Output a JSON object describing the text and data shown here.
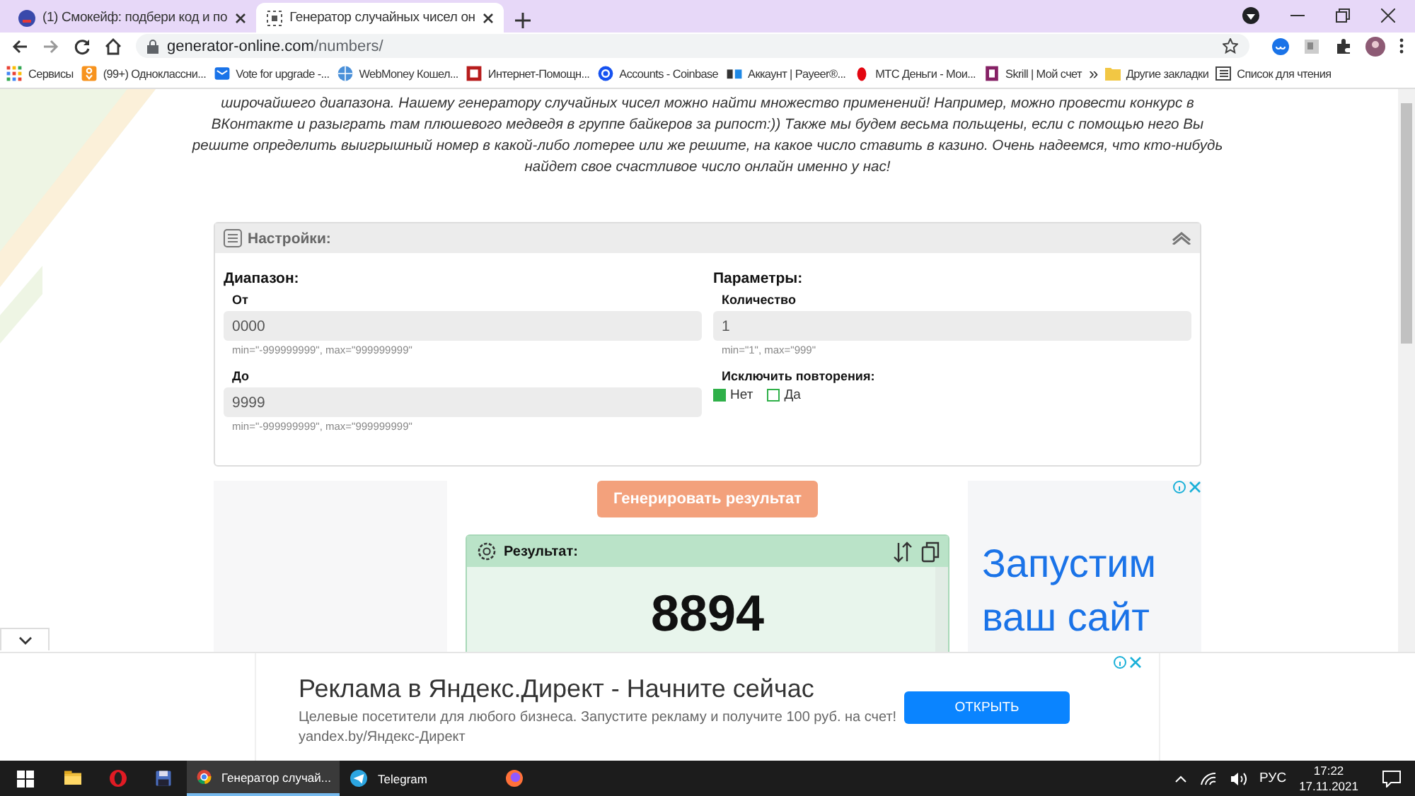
{
  "browser": {
    "tabs": [
      {
        "title": "(1) Смокейф: подбери код и по",
        "selected": false
      },
      {
        "title": "Генератор случайных чисел он",
        "selected": true
      }
    ],
    "url": {
      "host": "generator-online.com",
      "path": "/numbers/"
    },
    "bookmarks": [
      {
        "label": "Сервисы",
        "kind": "apps"
      },
      {
        "label": "(99+) Одноклассни...",
        "kind": "ok"
      },
      {
        "label": "Vote for upgrade -...",
        "kind": "mail"
      },
      {
        "label": "WebMoney Кошел...",
        "kind": "globe"
      },
      {
        "label": "Интернет-Помощн...",
        "kind": "red"
      },
      {
        "label": "Accounts - Coinbase",
        "kind": "coinbase"
      },
      {
        "label": "Аккаунт | Payeer®...",
        "kind": "payeer"
      },
      {
        "label": "МТС Деньги - Мои...",
        "kind": "mts"
      },
      {
        "label": "Skrill | Мой счет",
        "kind": "skrill"
      }
    ],
    "overflow": "»",
    "other_bookmarks": "Другие закладки",
    "reading_list": "Список для чтения"
  },
  "intro": [
    "широчайшего диапазона. Нашему генератору случайных чисел можно найти множество применений! Например, можно провести конкурс в",
    "ВКонтакте и разыграть там плюшевого медведя в группе байкеров за рипост:)) Также мы будем весьма польщены, если с помощью него Вы",
    "решите определить выигрышный номер в какой-либо лотерее или же решите, на какое число ставить в казино. Очень надеемся, что кто-нибудь",
    "найдет свое счастливое число онлайн именно у нас!"
  ],
  "settings": {
    "title": "Настройки:",
    "expanded": true,
    "range": {
      "heading": "Диапазон:",
      "fields": [
        {
          "label": "От",
          "value": "0000",
          "hint": "min=\"-999999999\", max=\"999999999\""
        },
        {
          "label": "До",
          "value": "9999",
          "hint": "min=\"-999999999\", max=\"999999999\""
        }
      ]
    },
    "params": {
      "heading": "Параметры:",
      "fields": [
        {
          "label": "Количество",
          "value": "1",
          "hint": "min=\"1\", max=\"999\""
        }
      ],
      "exclude": {
        "label": "Исключить повторения:",
        "options": [
          {
            "label": "Нет",
            "selected": true
          },
          {
            "label": "Да",
            "selected": false
          }
        ]
      }
    }
  },
  "generate_button": "Генерировать результат",
  "result": {
    "title": "Результат:",
    "value": "8894"
  },
  "side_ad": {
    "text": "Запустим ваш сайт"
  },
  "bottom_ad": {
    "title": "Реклама в Яндекс.Директ - Начните сейчас",
    "description": "Целевые посетители для любого бизнеса. Запустите рекламу и получите 100 руб. на счет!",
    "url": "yandex.by/Яндекс-Директ",
    "button": "ОТКРЫТЬ"
  },
  "taskbar": {
    "apps": [
      {
        "kind": "explorer",
        "selected": false
      },
      {
        "kind": "opera",
        "selected": false
      },
      {
        "kind": "disk",
        "selected": false
      },
      {
        "kind": "chrome",
        "label": "Генератор случай...",
        "selected": true
      },
      {
        "kind": "telegram",
        "label": "Telegram",
        "selected": false
      },
      {
        "kind": "firefox",
        "selected": false
      }
    ],
    "lang": "РУС",
    "time": "17:22",
    "date": "17.11.2021"
  }
}
